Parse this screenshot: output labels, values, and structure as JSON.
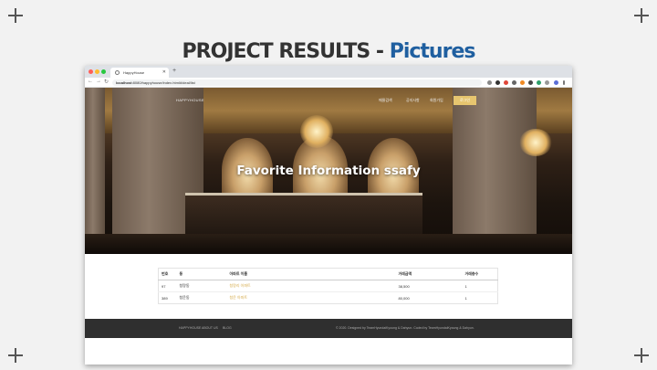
{
  "slide": {
    "title_main": "PROJECT RESULTS - ",
    "title_accent": "Pictures"
  },
  "browser": {
    "tab_title": "HappyHouse",
    "new_tab": "+",
    "url_host": "localhost",
    "url_path": ":8080/happyhouse/index.html#/deal/list",
    "nav": {
      "back": "←",
      "forward": "→",
      "reload": "↻"
    }
  },
  "site": {
    "brand": "HAPPYHOUSE",
    "nav_links": [
      "매물검색",
      "공지사항",
      "회원가입"
    ],
    "login_label": "로그인",
    "hero_title": "Favorite Information ssafy"
  },
  "table": {
    "headers": [
      "번호",
      "동",
      "아파트 이름",
      "거래금액",
      "거래층수"
    ],
    "rows": [
      [
        "97",
        "청량동",
        "청량리 아파트",
        "38,500",
        "1"
      ],
      [
        "389",
        "청운동",
        "청운 아파트",
        "80,000",
        "1"
      ]
    ]
  },
  "footer": {
    "links": [
      "HAPPYHOUSE",
      "ABOUT US",
      "BLOG"
    ],
    "copyright": "© 2020. Designed by TeamHyundaiKyoung & Dahyun. Coded by TeamHyundaiKyoung & Dahyun."
  },
  "colors": {
    "accent_title": "#1f5fa0",
    "login_button": "#e6c56f",
    "table_link": "#d4a947",
    "footer_bg": "#2f2f2f"
  }
}
